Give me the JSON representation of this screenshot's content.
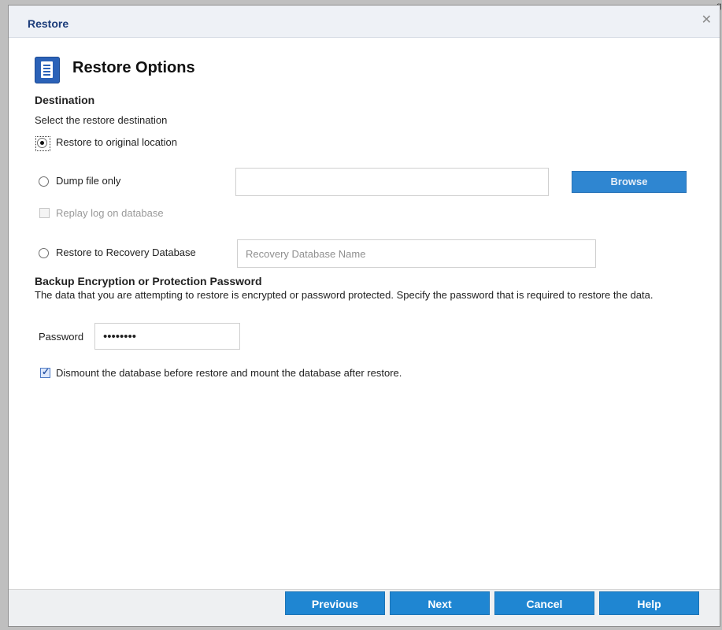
{
  "dialog": {
    "title": "Restore",
    "close_glyph": "✕"
  },
  "section": {
    "icon": "document-icon",
    "heading": "Restore Options"
  },
  "destination": {
    "heading": "Destination",
    "instruction": "Select the restore destination",
    "options": [
      {
        "label": "Restore to original location",
        "checked": true
      },
      {
        "label": "Dump file only",
        "checked": false
      },
      {
        "label": "Restore to Recovery Database",
        "checked": false
      }
    ],
    "dump_path_value": "",
    "browse_label": "Browse",
    "replay_log_label": "Replay log on database",
    "recovery_db_placeholder": "Recovery Database Name"
  },
  "encryption": {
    "heading": "Backup Encryption or Protection Password",
    "description": "The data that you are attempting to restore is encrypted or password protected. Specify the password that is required to restore the data.",
    "password_label": "Password",
    "password_value": "abcdefgh"
  },
  "dismount": {
    "label": "Dismount the database before restore and mount the database after restore.",
    "checked": true
  },
  "footer": {
    "previous": "Previous",
    "next": "Next",
    "cancel": "Cancel",
    "help": "Help"
  },
  "colors": {
    "title_text": "#1b3c7a",
    "primary_button": "#1f86d2",
    "browse_button": "#2f86d1"
  }
}
